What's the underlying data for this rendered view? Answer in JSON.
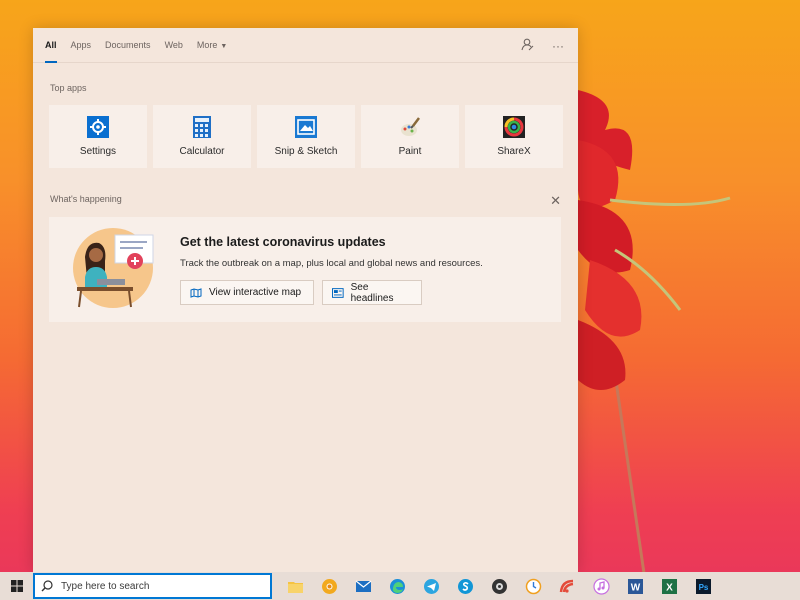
{
  "tabs": [
    {
      "label": "All",
      "active": true
    },
    {
      "label": "Apps"
    },
    {
      "label": "Documents"
    },
    {
      "label": "Web"
    },
    {
      "label": "More"
    }
  ],
  "top_apps": {
    "label": "Top apps",
    "items": [
      {
        "name": "Settings",
        "icon": "settings-icon"
      },
      {
        "name": "Calculator",
        "icon": "calculator-icon"
      },
      {
        "name": "Snip & Sketch",
        "icon": "snip-sketch-icon"
      },
      {
        "name": "Paint",
        "icon": "paint-icon"
      },
      {
        "name": "ShareX",
        "icon": "sharex-icon"
      }
    ]
  },
  "whats_happening": {
    "label": "What's happening",
    "title": "Get the latest coronavirus updates",
    "subtitle": "Track the outbreak on a map, plus local and global news and resources.",
    "btn_map": "View interactive map",
    "btn_headlines": "See headlines"
  },
  "taskbar": {
    "search_placeholder": "Type here to search",
    "icons": [
      "file-explorer-icon",
      "chrome-canary-icon",
      "mail-icon",
      "edge-icon",
      "telegram-icon",
      "skype-icon",
      "app-icon",
      "clock-app-icon",
      "app-icon",
      "itunes-icon",
      "word-icon",
      "excel-icon",
      "photoshop-icon"
    ]
  },
  "colors": {
    "accent": "#0067c0",
    "panel": "#f4e6dc"
  }
}
